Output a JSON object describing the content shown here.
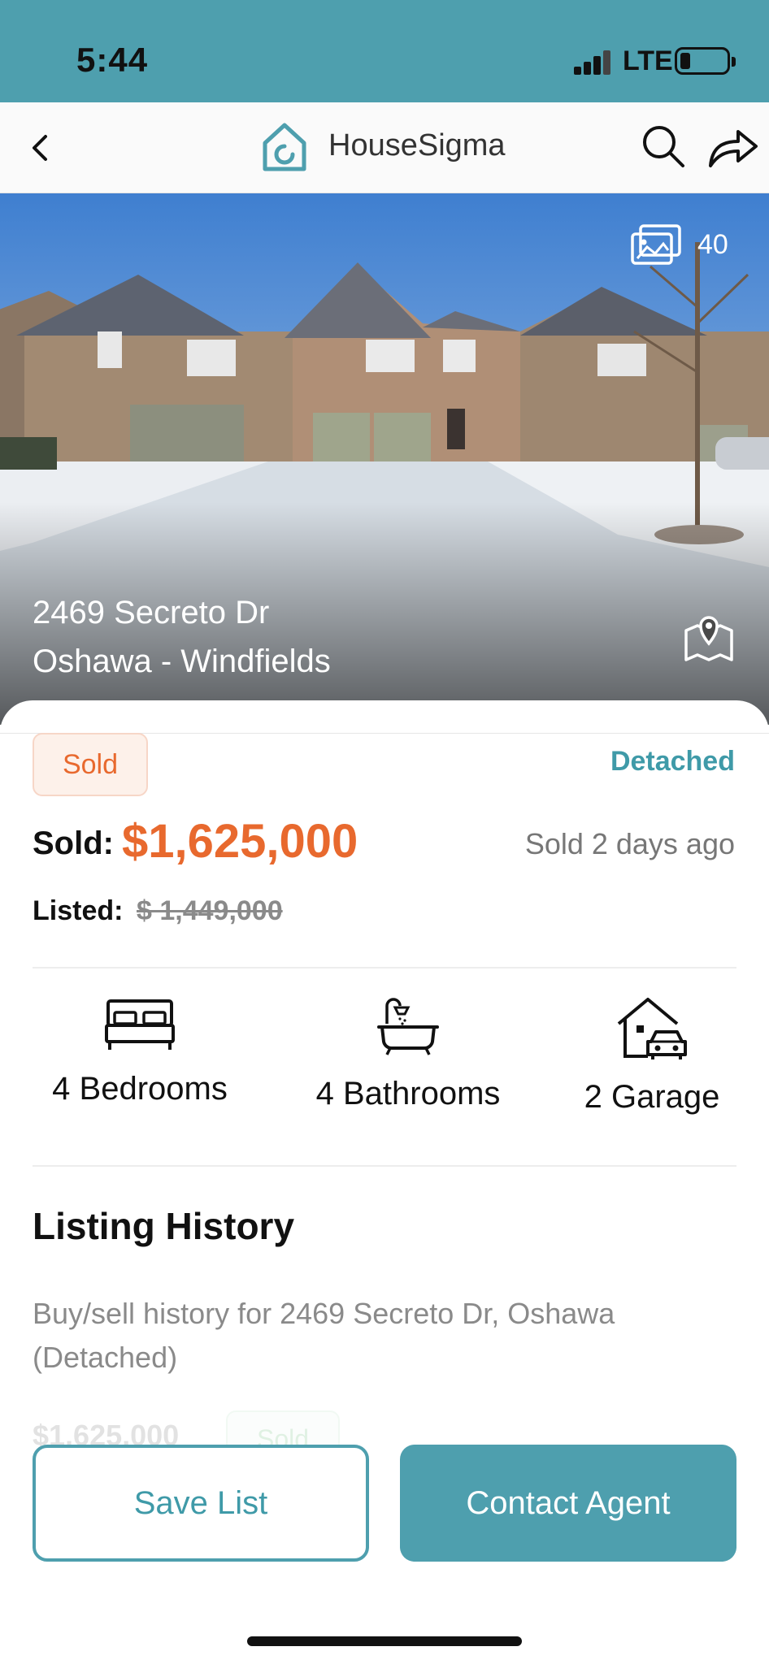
{
  "status_bar": {
    "time": "5:44",
    "network": "LTE"
  },
  "nav": {
    "brand": "HouseSigma"
  },
  "hero": {
    "photo_count": "40",
    "address_line1": "2469 Secreto Dr",
    "address_line2": "Oshawa - Windfields"
  },
  "listing": {
    "status_badge": "Sold",
    "property_type": "Detached",
    "sold_label": "Sold:",
    "sold_price": "$1,625,000",
    "sold_ago": "Sold 2 days ago",
    "listed_label": "Listed:",
    "listed_price": "$ 1,449,000"
  },
  "features": [
    {
      "icon": "bed-icon",
      "label": "4 Bedrooms"
    },
    {
      "icon": "bathtub-icon",
      "label": "4 Bathrooms"
    },
    {
      "icon": "garage-icon",
      "label": "2 Garage"
    }
  ],
  "history": {
    "title": "Listing History",
    "description": "Buy/sell history for 2469 Secreto Dr, Oshawa (Detached)",
    "peek_price": "$1,625,000",
    "peek_badge": "Sold"
  },
  "actions": {
    "save_label": "Save List",
    "contact_label": "Contact Agent"
  },
  "colors": {
    "brand_teal": "#4e9fae",
    "sold_orange": "#e8692e",
    "muted_gray": "#8a8a8a"
  }
}
